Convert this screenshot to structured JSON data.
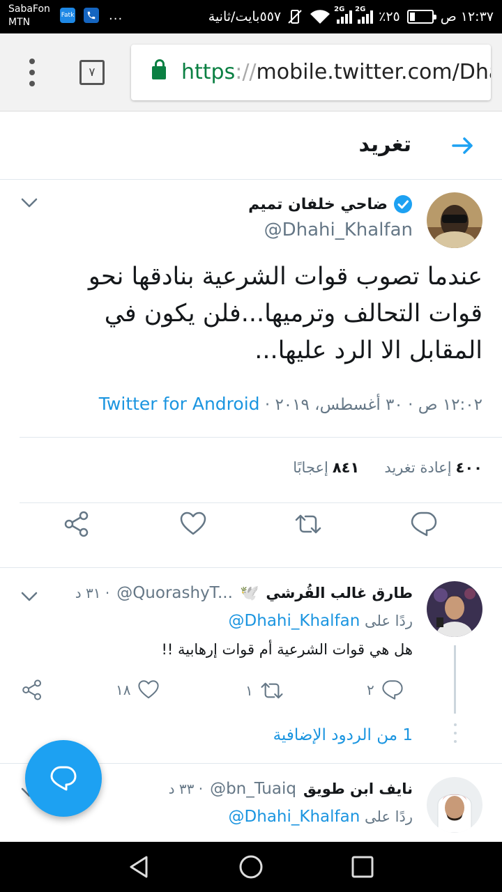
{
  "status_bar": {
    "carrier_1": "SabaFon",
    "carrier_2": "MTN",
    "app_badge": "Fatk",
    "more": "...",
    "speed": "٥٥٧بايت/ثانية",
    "network_1": "2G",
    "network_2": "2G",
    "battery": "٪٢٥",
    "battery_level": 0.25,
    "time": "١٢:٣٧ ص"
  },
  "browser": {
    "tab_count": "٧",
    "url_scheme": "https",
    "url_sep": "://",
    "url_rest": "mobile.twitter.com/Dha"
  },
  "header": {
    "title": "تغريد"
  },
  "tweet": {
    "display_name": "ضاحي خلفان تميم",
    "handle": "@Dhahi_Khalfan",
    "text": "عندما تصوب قوات الشرعية بنادقها نحو قوات التحالف وترميها...فلن يكون في المقابل الا الرد عليها...",
    "time": "١٢:٠٢ ص",
    "date": "٣٠ أغسطس، ٢٠١٩",
    "sep": " · ",
    "source": "Twitter for Android",
    "retweets_count": "٤٠٠",
    "retweets_label": "إعادة تغريد",
    "likes_count": "٨٤١",
    "likes_label": "إعجابًا"
  },
  "replies": [
    {
      "display_name": "طارق غالب القُرشي",
      "flag": "🕊️",
      "handle": "@QuorashyT...",
      "time": "٣١ د",
      "reply_to_label": "ردًا على",
      "reply_to_handle": "@Dhahi_Khalfan",
      "text": "هل هي قوات الشرعية أم قوات إرهابية !!",
      "reply_count": "٢",
      "retweet_count": "١",
      "like_count": "١٨",
      "more_replies": "1 من الردود الإضافية"
    },
    {
      "display_name": "نايف ابن طويق",
      "handle": "@bn_Tuaiq",
      "time": "٣٣ د",
      "reply_to_label": "ردًا على",
      "reply_to_handle": "@Dhahi_Khalfan"
    }
  ],
  "colors": {
    "twitter_blue": "#1da1f2",
    "link_blue": "#1b95e0",
    "secure_green": "#0b8043",
    "muted": "#657786"
  }
}
